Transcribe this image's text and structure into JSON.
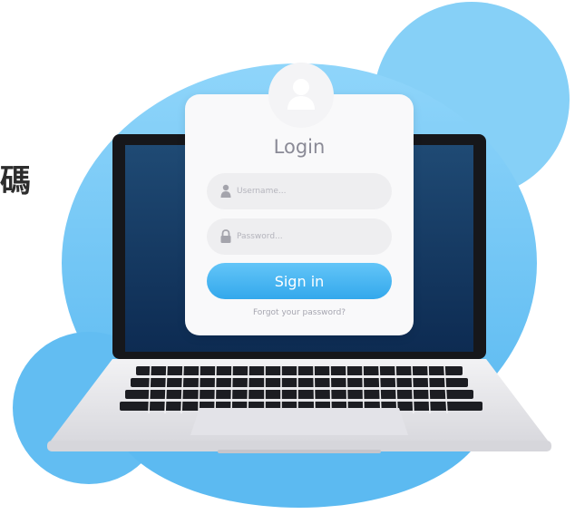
{
  "side_text": "碼",
  "login": {
    "title": "Login",
    "username_placeholder": "Username...",
    "password_placeholder": "Password...",
    "signin_label": "Sign in",
    "forgot_label": "Forgot your password?"
  },
  "colors": {
    "blob_light": "#89d2f8",
    "blob_mid": "#5fbcf2",
    "screen_top": "#1b3f66",
    "screen_bottom": "#0f2d55",
    "button": "#3aabee"
  },
  "icons": {
    "avatar": "user-avatar-icon",
    "username": "user-icon",
    "password": "lock-icon"
  }
}
